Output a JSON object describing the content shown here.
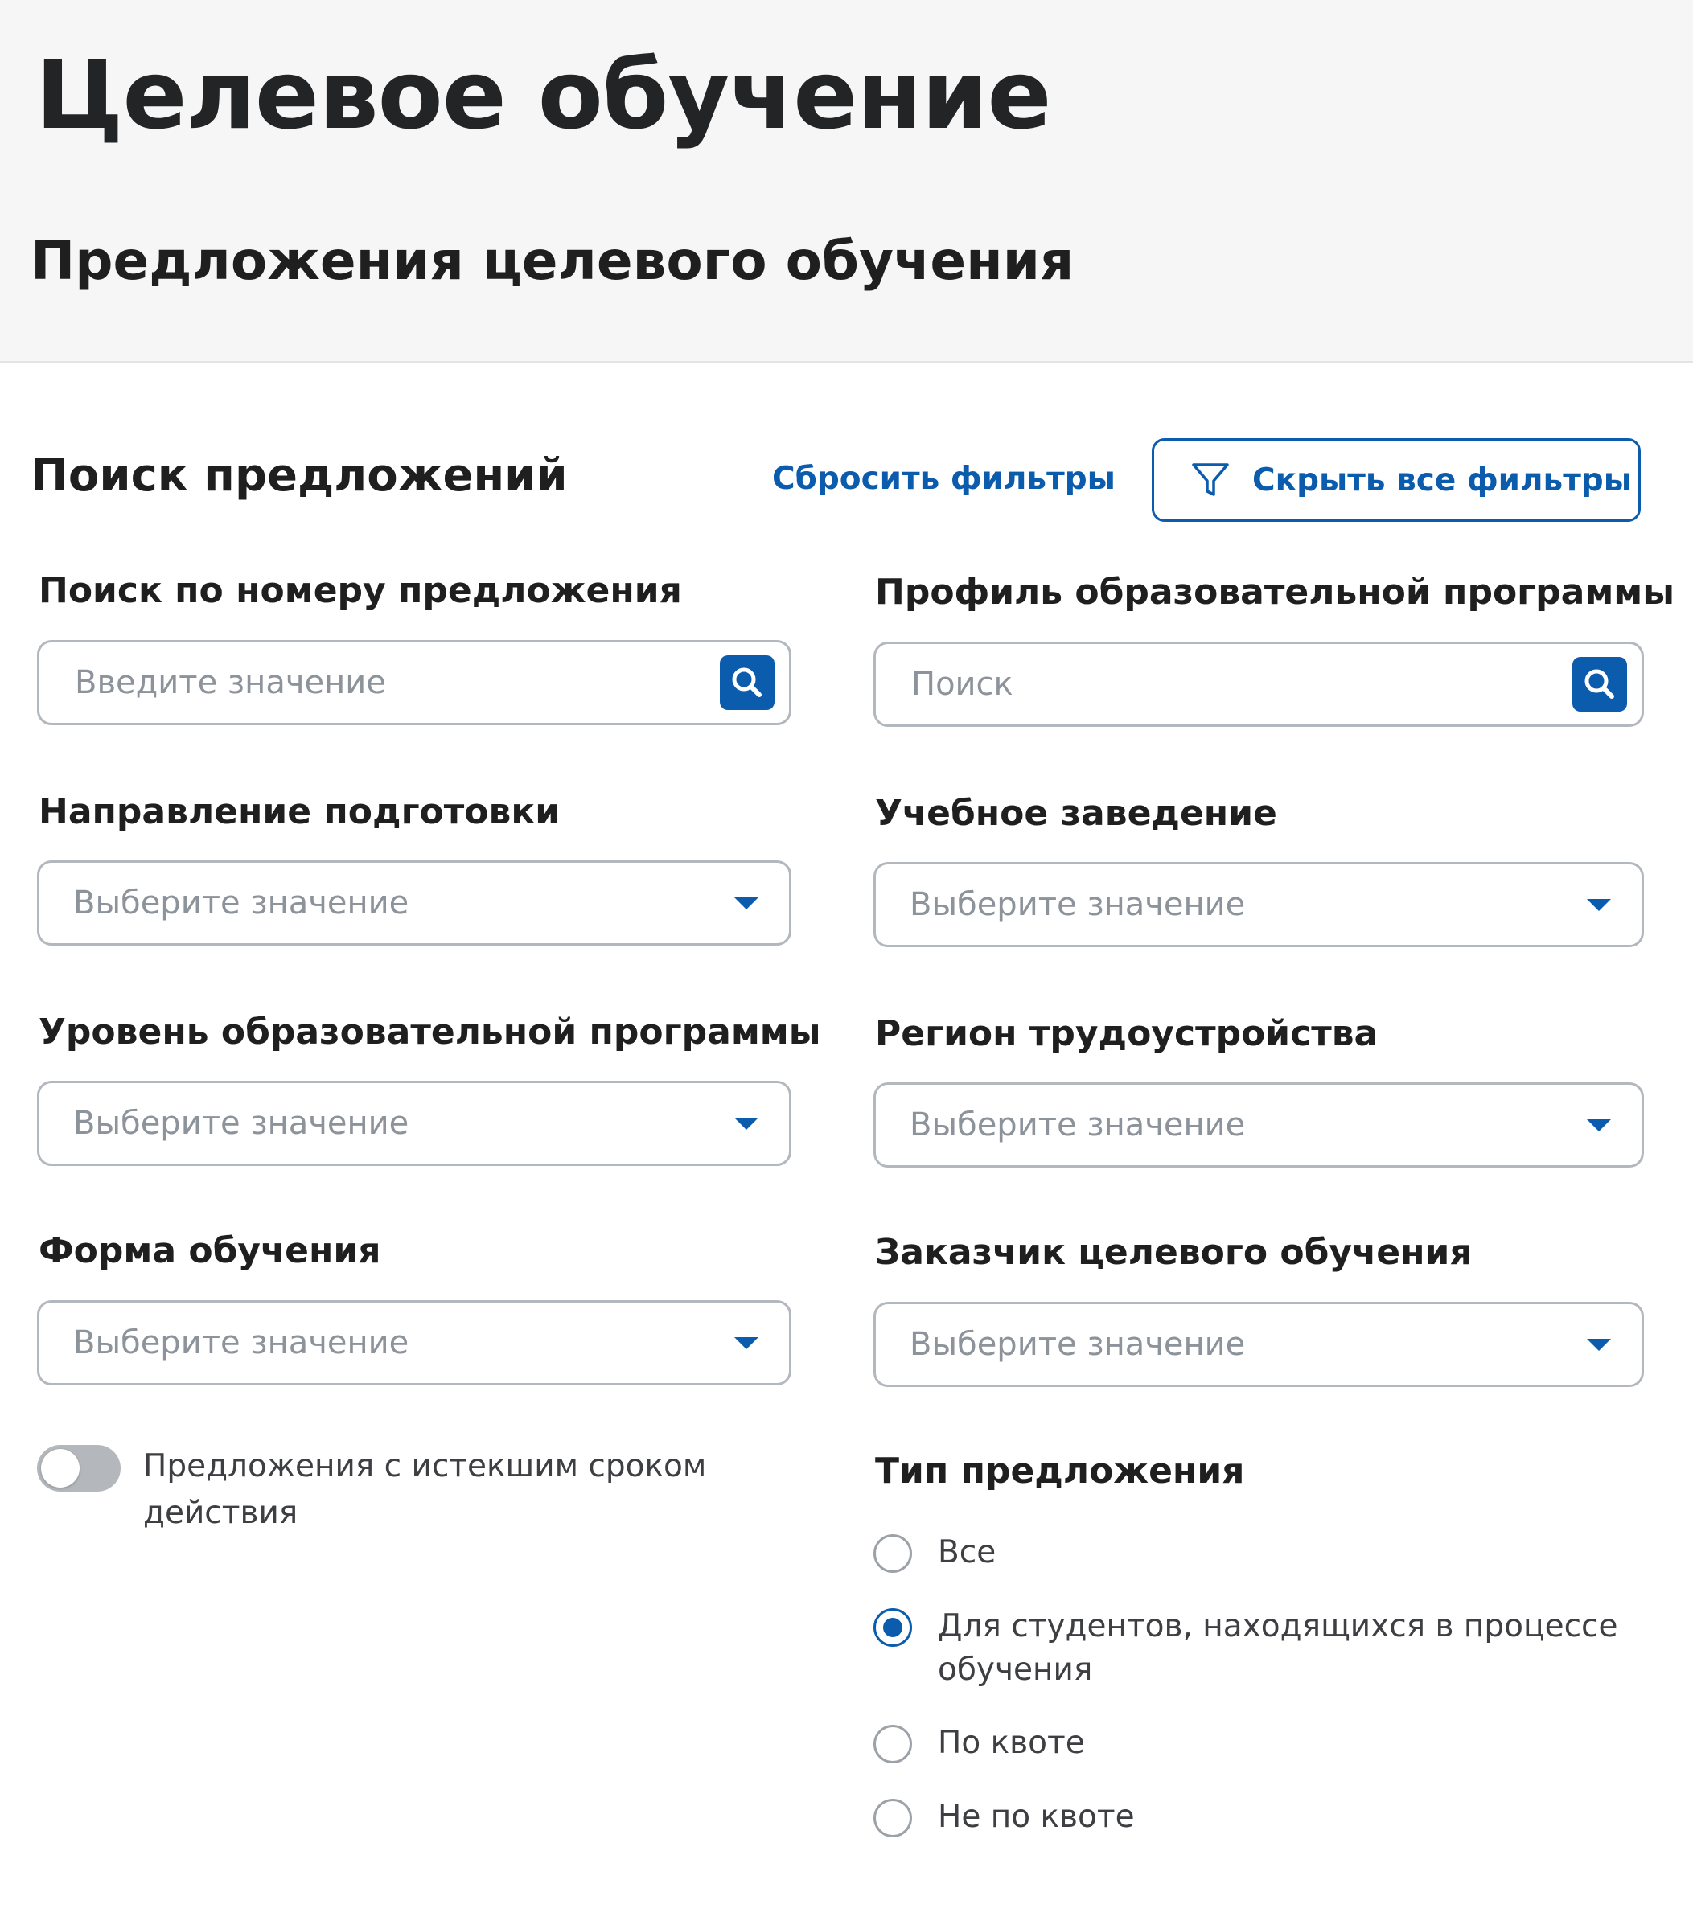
{
  "header": {
    "title": "Целевое обучение",
    "subtitle": "Предложения целевого обучения"
  },
  "search": {
    "title": "Поиск предложений",
    "reset_label": "Сбросить фильтры",
    "hide_filters_label": "Скрыть все фильтры"
  },
  "fields": {
    "offer_number": {
      "label": "Поиск по номеру предложения",
      "placeholder": "Введите значение"
    },
    "profile": {
      "label": "Профиль образовательной программы",
      "placeholder": "Поиск"
    },
    "direction": {
      "label": "Направление подготовки",
      "value": "Выберите значение"
    },
    "institution": {
      "label": "Учебное заведение",
      "value": "Выберите значение"
    },
    "level": {
      "label": "Уровень образовательной программы",
      "value": "Выберите значение"
    },
    "region": {
      "label": "Регион трудоустройства",
      "value": "Выберите значение"
    },
    "form": {
      "label": "Форма обучения",
      "value": "Выберите значение"
    },
    "customer": {
      "label": "Заказчик целевого обучения",
      "value": "Выберите значение"
    }
  },
  "expired_toggle": {
    "label": "Предложения с истекшим сроком действия",
    "checked": false
  },
  "offer_type": {
    "title": "Тип предложения",
    "options": [
      {
        "label": "Все",
        "checked": false
      },
      {
        "label": "Для студентов, находящихся в процессе обучения",
        "checked": true
      },
      {
        "label": "По квоте",
        "checked": false
      },
      {
        "label": "Не по квоте",
        "checked": false
      }
    ]
  },
  "colors": {
    "accent": "#0b5cad",
    "header_bg": "#f6f6f6",
    "border": "#b3b8bf",
    "placeholder": "#8d939b",
    "toggle_off": "#b4b8bd"
  },
  "icons": {
    "filter": "filter-funnel-icon",
    "search": "magnifier-icon",
    "dropdown": "chevron-down-icon"
  }
}
